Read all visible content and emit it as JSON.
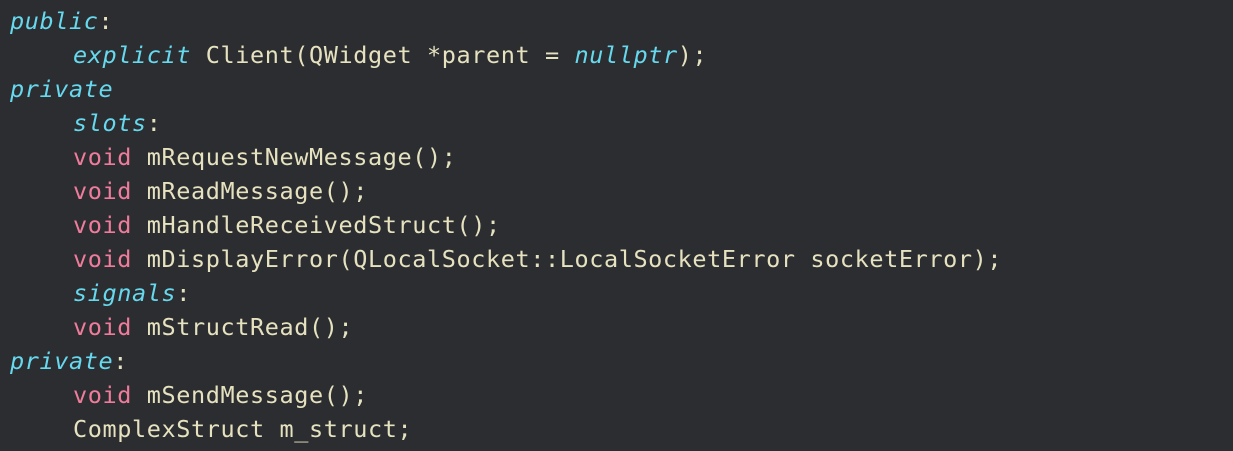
{
  "code": {
    "line1": {
      "kw": "public",
      "punct": ":"
    },
    "line2": {
      "kw": "explicit",
      "rest1": " Client(QWidget ",
      "op": "*",
      "rest2": "parent = ",
      "kw2": "nullptr",
      "rest3": ");"
    },
    "line3": {
      "kw": "private"
    },
    "line4": {
      "kw": "slots",
      "punct": ":"
    },
    "line5": {
      "type": "void",
      "rest": " mRequestNewMessage();"
    },
    "line6": {
      "type": "void",
      "rest": " mReadMessage();"
    },
    "line7": {
      "type": "void",
      "rest": " mHandleReceivedStruct();"
    },
    "line8": {
      "type": "void",
      "rest": " mDisplayError(QLocalSocket::LocalSocketError socketError);"
    },
    "line9": {
      "kw": "signals",
      "punct": ":"
    },
    "line10": {
      "type": "void",
      "rest": " mStructRead();"
    },
    "line11": {
      "kw": "private",
      "punct": ":"
    },
    "line12": {
      "type": "void",
      "rest": " mSendMessage();"
    },
    "line13": {
      "rest": "ComplexStruct m_struct;"
    }
  },
  "colors": {
    "background": "#2c2d30",
    "keyword": "#66d9ef",
    "type": "#f07c9c",
    "text": "#e6e2c0"
  }
}
